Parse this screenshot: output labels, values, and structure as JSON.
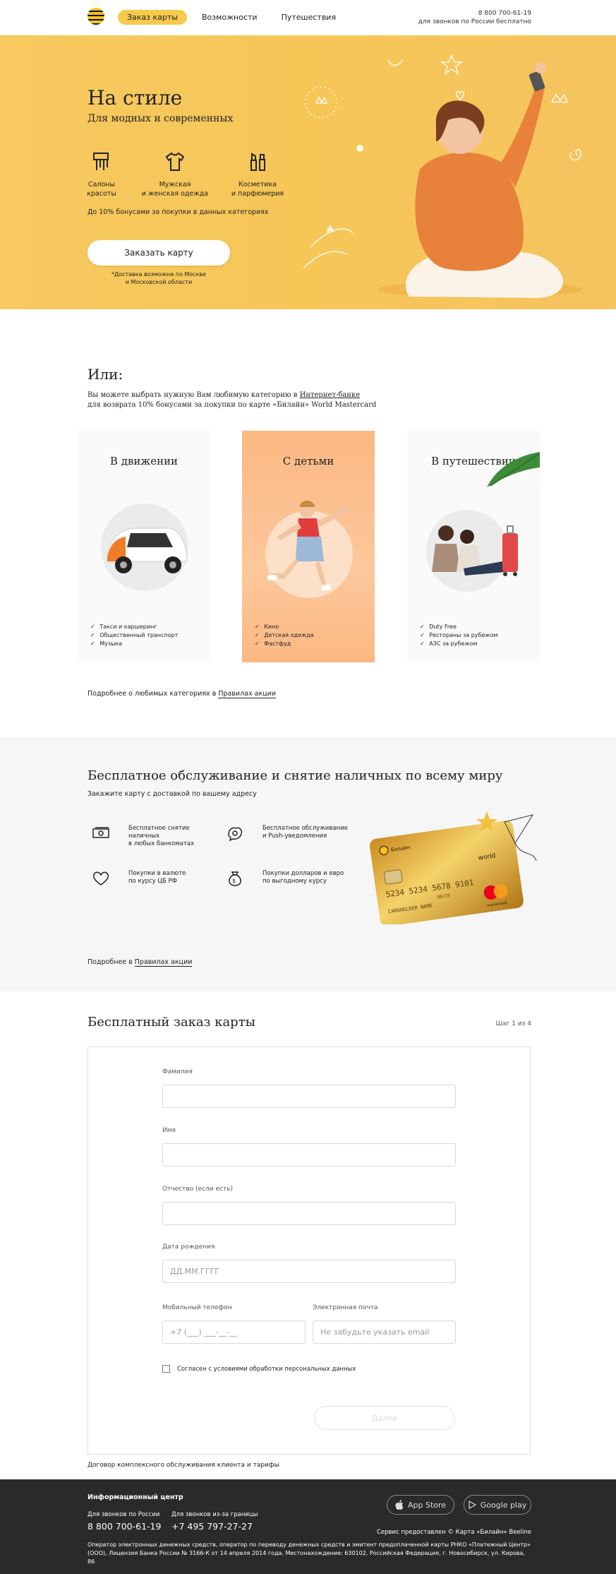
{
  "header": {
    "nav": [
      "Заказ карты",
      "Возможности",
      "Путешествия"
    ],
    "phone": "8 800 700-61-19",
    "phone_note": "для звонков по России бесплатно"
  },
  "hero": {
    "title": "На стиле",
    "subtitle": "Для модных и современных",
    "features": [
      {
        "label": "Салоны\nкрасоты",
        "icon": "comb-icon"
      },
      {
        "label": "Мужская\nи женская одежда",
        "icon": "tshirt-icon"
      },
      {
        "label": "Косметика\nи парфюмерия",
        "icon": "cosmetics-icon"
      }
    ],
    "bonus": "До 10% бонусами за покупки в данных категориях",
    "button": "Заказать карту",
    "note": "*Доставка возможна по Москве\nи Московской области",
    "colors": {
      "bg": "#f6c657"
    }
  },
  "or_section": {
    "title": "Или:",
    "text_before": "Вы можете выбрать нужную Вам любимую категорию в ",
    "link": "Интернет-банке",
    "text_after": "для возврата 10% бонусами за покупки по карте «Билайн» World Mastercard",
    "cards": [
      {
        "title": "В движении",
        "items": [
          "Такси и каршеринг",
          "Общественный транспорт",
          "Музыка"
        ]
      },
      {
        "title": "С детьми",
        "items": [
          "Кино",
          "Детская одежда",
          "Фастфуд"
        ]
      },
      {
        "title": "В путешествии",
        "items": [
          "Duty Free",
          "Рестораны за рубежом",
          "АЗС за рубежом"
        ]
      }
    ],
    "more_text": "Подробнее о любимых категориях в ",
    "more_link": "Правилах акции"
  },
  "service": {
    "title": "Бесплатное обслуживание и снятие наличных по всему миру",
    "subtitle": "Закажите карту с доставкой по вашему адресу",
    "items": [
      {
        "text": "Бесплатное снятие\nналичных\nв любых банкоматах",
        "icon": "cash-icon"
      },
      {
        "text": "Бесплатное обслуживание\nи Push-уведомления",
        "icon": "hand-icon"
      },
      {
        "text": "Покупки в валюте\nпо курсу ЦБ РФ",
        "icon": "heart-icon"
      },
      {
        "text": "Покупки долларов и евро\nпо выгодному курсу",
        "icon": "money-bag-icon"
      }
    ],
    "more_text": "Подробнее в ",
    "more_link": "Правилах акции",
    "card": {
      "brand": "Билайн",
      "tier": "world",
      "number": "5234 5234 5678 9101",
      "valid": "08/25",
      "holder": "CARDHOLDER NAME",
      "network": "mastercard"
    }
  },
  "form": {
    "title": "Бесплатный заказ карты",
    "step": "Шаг 1 из 4",
    "fields": {
      "lastname": {
        "label": "Фамилия",
        "placeholder": ""
      },
      "firstname": {
        "label": "Имя",
        "placeholder": ""
      },
      "patronymic": {
        "label": "Отчество (если есть)",
        "placeholder": ""
      },
      "birthdate": {
        "label": "Дата рождения",
        "placeholder": "ДД.ММ.ГГГГ"
      },
      "phone": {
        "label": "Мобильный телефон",
        "placeholder": "+7 (___) ___-__-__"
      },
      "email": {
        "label": "Электронная почта",
        "placeholder": "Не забудьте указать email"
      }
    },
    "consent": "Согласен с условиями обработки персональных данных",
    "next": "Далее",
    "contract": "Договор комплексного обслуживания клиента и тарифы"
  },
  "footer": {
    "title": "Информационный центр",
    "russia_label": "Для звонков по России",
    "russia_phone": "8 800 700-61-19",
    "abroad_label": "Для звонков из-за границы",
    "abroad_phone": "+7 495 797-27-27",
    "appstore": "App Store",
    "googleplay": "Google play",
    "service_by": "Сервис предоставлен © Карта «Билайн» Beeline",
    "legal": "Оператор электронных денежных средств, оператор по переводу денежных средств и эмитент предоплаченной карты РНКО «Платежный Центр» (ООО), Лицензия Банка России № 3166-К от 14 апреля 2014 года. Местонахождение: 630102, Российская Федерация, г. Новосибирск, ул. Кирова, 86"
  }
}
